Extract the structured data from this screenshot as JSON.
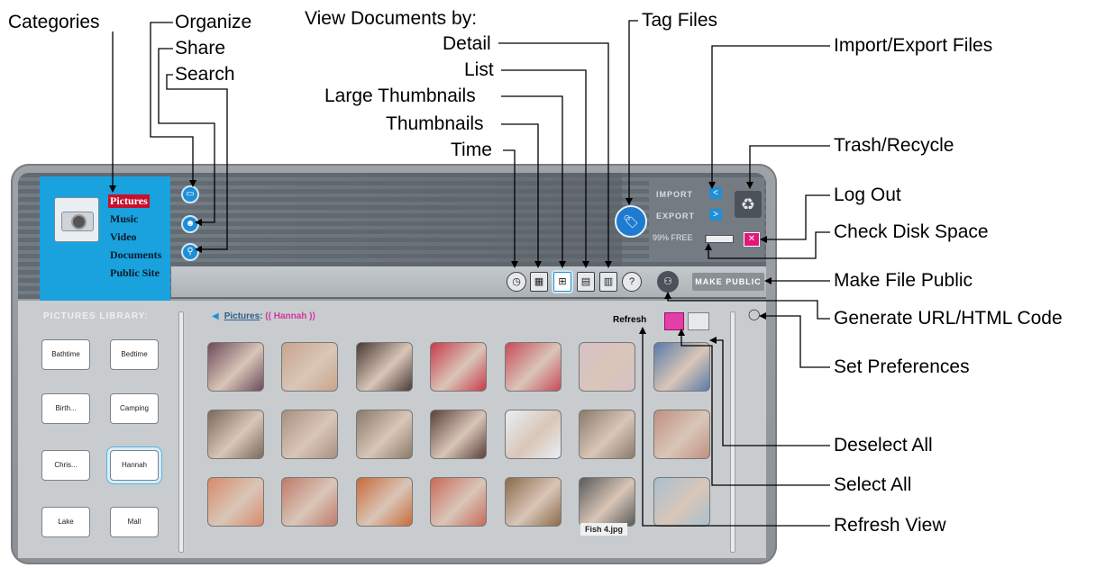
{
  "annotations": {
    "categories": "Categories",
    "organize": "Organize",
    "share": "Share",
    "search": "Search",
    "view_by": "View Documents by:",
    "detail": "Detail",
    "list": "List",
    "large_thumbnails": "Large Thumbnails",
    "thumbnails": "Thumbnails",
    "time": "Time",
    "tag_files": "Tag Files",
    "import_export": "Import/Export Files",
    "trash": "Trash/Recycle",
    "log_out": "Log Out",
    "check_disk": "Check Disk Space",
    "make_public": "Make File Public",
    "generate_url": "Generate URL/HTML Code",
    "set_prefs": "Set Preferences",
    "deselect_all": "Deselect All",
    "select_all": "Select All",
    "refresh_view": "Refresh View"
  },
  "categories": [
    "Pictures",
    "Music",
    "Video",
    "Documents",
    "Public Site"
  ],
  "panel": {
    "import": "IMPORT",
    "export": "EXPORT",
    "disk_free": "99% FREE",
    "disk_used_fraction": 0.01,
    "make_public": "MAKE PUBLIC"
  },
  "library": {
    "title": "PICTURES LIBRARY:",
    "folders": [
      "Bathtime",
      "Bedtime",
      "Birth...",
      "Camping",
      "Chris...",
      "Hannah",
      "Lake",
      "Mall"
    ],
    "selected": "Hannah"
  },
  "breadcrumb": {
    "root": "Pictures",
    "sep": ":",
    "current": "(( Hannah ))"
  },
  "toolbar": {
    "refresh": "Refresh"
  },
  "photos": {
    "caption": "Fish 4.jpg",
    "colors": [
      "#6b4a5a",
      "#c9a58c",
      "#4a3a36",
      "#c93a4a",
      "#c84a5a",
      "#d8c0c8",
      "#5a7aa8",
      "#7a6a5a",
      "#a89080",
      "#8a7a6a",
      "#5a4038",
      "#e8eef6",
      "#8a7a6a",
      "#c09080",
      "#d88a6a",
      "#c07a6a",
      "#c86a3a",
      "#c86a5a",
      "#8a6a4a",
      "#5a5a5a",
      "#a8c0d0"
    ]
  },
  "colors": {
    "accent": "#19a2dd",
    "select_pink": "#e23fa8"
  }
}
